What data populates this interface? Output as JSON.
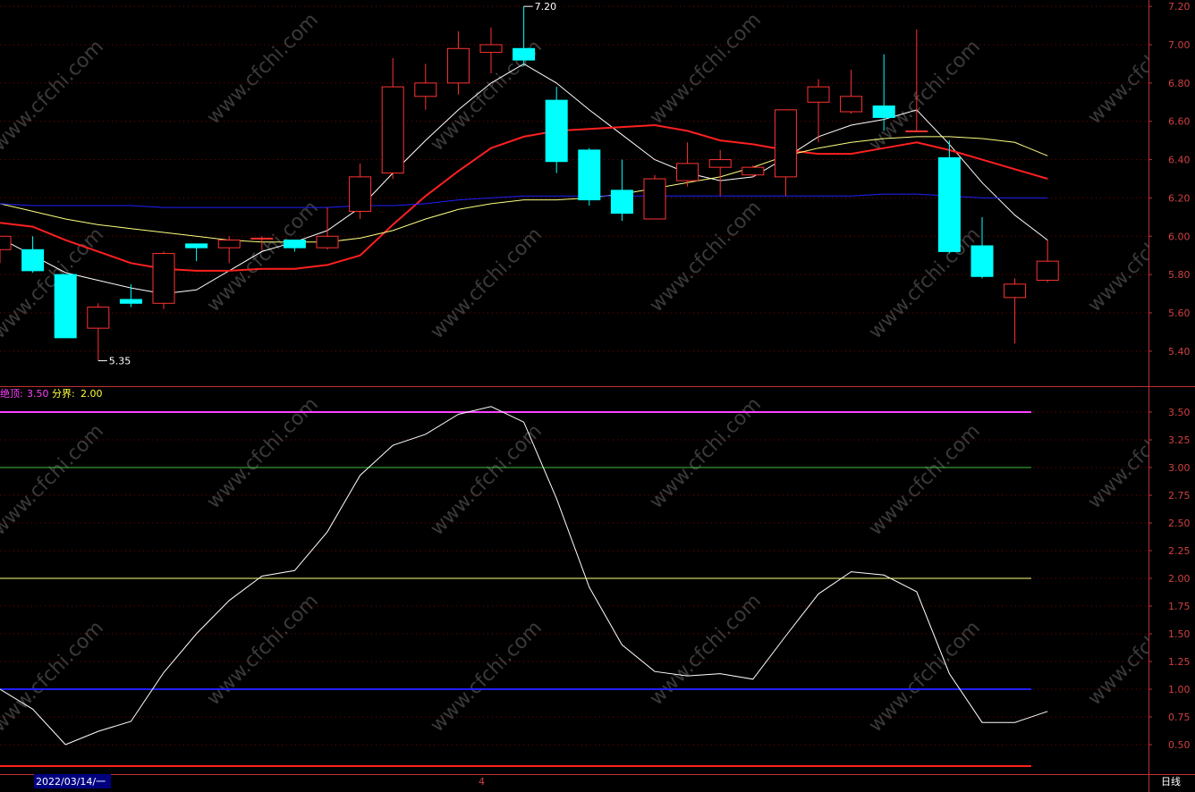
{
  "chart_data": [
    {
      "type": "candlestick",
      "name": "",
      "yticks": [
        "7.20",
        "7.00",
        "6.80",
        "6.60",
        "6.40",
        "6.20",
        "6.00",
        "5.80",
        "5.60",
        "5.40"
      ],
      "ylim": [
        5.33,
        7.25
      ],
      "candles": [
        {
          "o": 5.93,
          "h": 6.0,
          "l": 5.86,
          "c": 6.0
        },
        {
          "o": 5.93,
          "h": 6.0,
          "l": 5.81,
          "c": 5.82
        },
        {
          "o": 5.8,
          "h": 5.8,
          "l": 5.47,
          "c": 5.47
        },
        {
          "o": 5.52,
          "h": 5.65,
          "l": 5.35,
          "c": 5.63
        },
        {
          "o": 5.67,
          "h": 5.75,
          "l": 5.63,
          "c": 5.65
        },
        {
          "o": 5.65,
          "h": 5.92,
          "l": 5.62,
          "c": 5.91
        },
        {
          "o": 5.96,
          "h": 5.96,
          "l": 5.87,
          "c": 5.94
        },
        {
          "o": 5.94,
          "h": 6.0,
          "l": 5.86,
          "c": 5.98
        },
        {
          "o": 5.99,
          "h": 6.0,
          "l": 5.93,
          "c": 5.99
        },
        {
          "o": 5.98,
          "h": 5.98,
          "l": 5.92,
          "c": 5.94
        },
        {
          "o": 5.94,
          "h": 6.15,
          "l": 5.93,
          "c": 6.0
        },
        {
          "o": 6.13,
          "h": 6.38,
          "l": 6.09,
          "c": 6.31
        },
        {
          "o": 6.33,
          "h": 6.93,
          "l": 6.3,
          "c": 6.78
        },
        {
          "o": 6.73,
          "h": 6.9,
          "l": 6.66,
          "c": 6.8
        },
        {
          "o": 6.8,
          "h": 7.07,
          "l": 6.74,
          "c": 6.98
        },
        {
          "o": 6.96,
          "h": 7.09,
          "l": 6.85,
          "c": 7.0
        },
        {
          "o": 6.98,
          "h": 7.2,
          "l": 6.89,
          "c": 6.92
        },
        {
          "o": 6.71,
          "h": 6.78,
          "l": 6.33,
          "c": 6.39
        },
        {
          "o": 6.45,
          "h": 6.46,
          "l": 6.16,
          "c": 6.19
        },
        {
          "o": 6.24,
          "h": 6.4,
          "l": 6.08,
          "c": 6.12
        },
        {
          "o": 6.09,
          "h": 6.32,
          "l": 6.09,
          "c": 6.3
        },
        {
          "o": 6.29,
          "h": 6.49,
          "l": 6.26,
          "c": 6.38
        },
        {
          "o": 6.36,
          "h": 6.45,
          "l": 6.21,
          "c": 6.4
        },
        {
          "o": 6.32,
          "h": 6.37,
          "l": 6.31,
          "c": 6.36
        },
        {
          "o": 6.31,
          "h": 6.66,
          "l": 6.21,
          "c": 6.66
        },
        {
          "o": 6.7,
          "h": 6.82,
          "l": 6.49,
          "c": 6.78
        },
        {
          "o": 6.65,
          "h": 6.87,
          "l": 6.64,
          "c": 6.73
        },
        {
          "o": 6.68,
          "h": 6.95,
          "l": 6.55,
          "c": 6.62
        },
        {
          "o": 6.55,
          "h": 7.08,
          "l": 6.55,
          "c": 6.55
        },
        {
          "o": 6.41,
          "h": 6.5,
          "l": 5.91,
          "c": 5.92
        },
        {
          "o": 5.95,
          "h": 6.1,
          "l": 5.78,
          "c": 5.79
        },
        {
          "o": 5.68,
          "h": 5.78,
          "l": 5.44,
          "c": 5.75
        },
        {
          "o": 5.77,
          "h": 5.98,
          "l": 5.76,
          "c": 5.87
        }
      ],
      "ma_lines": [
        {
          "color": "#ffffff",
          "values": [
            5.99,
            5.9,
            5.81,
            5.77,
            5.73,
            5.7,
            5.72,
            5.82,
            5.92,
            5.97,
            6.03,
            6.15,
            6.33,
            6.5,
            6.66,
            6.8,
            6.9,
            6.8,
            6.66,
            6.53,
            6.4,
            6.33,
            6.29,
            6.31,
            6.41,
            6.52,
            6.58,
            6.61,
            6.66,
            6.48,
            6.28,
            6.11,
            5.98
          ]
        },
        {
          "color": "#ff2020",
          "values": [
            6.07,
            6.05,
            5.98,
            5.92,
            5.86,
            5.83,
            5.82,
            5.82,
            5.83,
            5.83,
            5.85,
            5.9,
            6.06,
            6.21,
            6.34,
            6.46,
            6.52,
            6.55,
            6.56,
            6.57,
            6.58,
            6.55,
            6.5,
            6.48,
            6.45,
            6.43,
            6.43,
            6.46,
            6.49,
            6.45,
            6.4,
            6.35,
            6.3
          ]
        },
        {
          "color": "#ffff80",
          "values": [
            6.17,
            6.13,
            6.09,
            6.06,
            6.04,
            6.02,
            6.0,
            5.98,
            5.97,
            5.97,
            5.97,
            5.99,
            6.03,
            6.09,
            6.14,
            6.17,
            6.19,
            6.19,
            6.2,
            6.22,
            6.25,
            6.28,
            6.31,
            6.36,
            6.42,
            6.46,
            6.49,
            6.51,
            6.52,
            6.52,
            6.51,
            6.49,
            6.42
          ]
        },
        {
          "color": "#2020ff",
          "values": [
            6.17,
            6.16,
            6.16,
            6.16,
            6.16,
            6.15,
            6.15,
            6.15,
            6.15,
            6.15,
            6.15,
            6.16,
            6.16,
            6.17,
            6.19,
            6.2,
            6.21,
            6.21,
            6.21,
            6.21,
            6.21,
            6.21,
            6.21,
            6.21,
            6.21,
            6.21,
            6.21,
            6.22,
            6.22,
            6.21,
            6.2,
            6.2,
            6.2
          ]
        }
      ],
      "annotations": [
        {
          "text": "7.20",
          "x_index": 16,
          "y": 7.2
        },
        {
          "text": "5.35",
          "x_index": 3,
          "y": 5.35
        }
      ]
    },
    {
      "type": "line",
      "name": "",
      "legend": [
        {
          "label": "绝顶:",
          "value": "3.50",
          "color": "#ff40ff"
        },
        {
          "label": "分界:",
          "value": "2.00",
          "color": "#ffff40"
        }
      ],
      "yticks": [
        "3.50",
        "3.25",
        "3.00",
        "2.75",
        "2.50",
        "2.25",
        "2.00",
        "1.75",
        "1.50",
        "1.25",
        "1.00",
        "0.75",
        "0.50"
      ],
      "ylim": [
        0.33,
        3.7
      ],
      "hlines": [
        {
          "value": 3.5,
          "color": "#ff40ff"
        },
        {
          "value": 3.0,
          "color": "#40c040"
        },
        {
          "value": 2.0,
          "color": "#ffff80"
        },
        {
          "value": 1.0,
          "color": "#2020ff"
        },
        {
          "value": 0.3,
          "color": "#ff2020"
        }
      ],
      "series": [
        {
          "color": "#ffffff",
          "values": [
            1.0,
            0.82,
            0.5,
            0.62,
            0.71,
            1.15,
            1.5,
            1.8,
            2.02,
            2.07,
            2.42,
            2.93,
            3.2,
            3.3,
            3.48,
            3.55,
            3.41,
            2.72,
            1.92,
            1.4,
            1.16,
            1.12,
            1.14,
            1.09,
            1.48,
            1.86,
            2.06,
            2.03,
            1.88,
            1.14,
            0.7,
            0.7,
            0.8
          ]
        }
      ]
    }
  ],
  "footer": {
    "date_label": "2022/03/14/一",
    "marker": "4",
    "period": "日线"
  },
  "watermark": "www.cfchi.com"
}
